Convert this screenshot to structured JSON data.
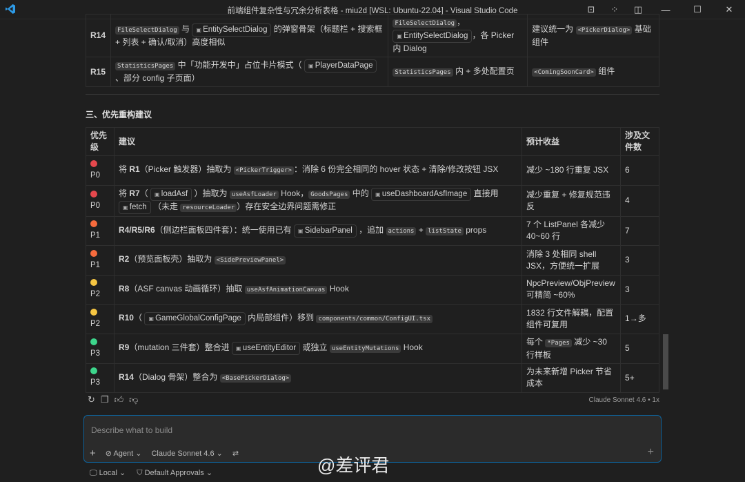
{
  "window": {
    "title": "前端组件复杂性与冗余分析表格 - miu2d [WSL: Ubuntu-22.04] - Visual Studio Code"
  },
  "upper_table": {
    "rows": [
      {
        "id": "R14",
        "desc": [
          {
            "c": "FileSelectDialog"
          },
          {
            "t": " 与 "
          },
          {
            "r": "EntitySelectDialog"
          },
          {
            "t": " 的弹窗骨架（标题栏 + 搜索框 + 列表 + 确认/取消）高度相似"
          }
        ],
        "loc": [
          {
            "c": "FileSelectDialog"
          },
          {
            "t": "，"
          },
          {
            "r": "EntitySelectDialog"
          },
          {
            "t": "，各 Picker 内 Dialog"
          }
        ],
        "suggest": [
          {
            "t": "建议统一为 "
          },
          {
            "c": "<PickerDialog>"
          },
          {
            "t": " 基础组件"
          }
        ]
      },
      {
        "id": "R15",
        "desc": [
          {
            "c": "StatisticsPages"
          },
          {
            "t": " 中「功能开发中」占位卡片模式（ "
          },
          {
            "r": "PlayerDataPage"
          },
          {
            "t": " 、部分 config 子页面）"
          }
        ],
        "loc": [
          {
            "c": "StatisticsPages"
          },
          {
            "t": " 内 + 多处配置页"
          }
        ],
        "suggest": [
          {
            "c": "<ComingSoonCard>"
          },
          {
            "t": " 组件"
          }
        ]
      }
    ]
  },
  "section_heading": "三、优先重构建议",
  "priority_table": {
    "headers": [
      "优先级",
      "建议",
      "预计收益",
      "涉及文件数"
    ],
    "colors": {
      "P0": "#e5484d",
      "P1": "#f76b3d",
      "P2": "#f5c542",
      "P3": "#3dd68c"
    },
    "rows": [
      {
        "p": "P0",
        "s": [
          {
            "t": "将 "
          },
          {
            "b": "R1"
          },
          {
            "t": "（Picker 触发器）抽取为 "
          },
          {
            "c": "<PickerTrigger>"
          },
          {
            "t": "：消除 6 份完全相同的 hover 状态 + 清除/修改按钮 JSX"
          }
        ],
        "gain": "减少 ~180 行重复 JSX",
        "files": "6"
      },
      {
        "p": "P0",
        "s": [
          {
            "t": "将 "
          },
          {
            "b": "R7"
          },
          {
            "t": "（ "
          },
          {
            "r": "loadAsf"
          },
          {
            "t": " ）抽取为 "
          },
          {
            "c": "useAsfLoader"
          },
          {
            "t": " Hook，"
          },
          {
            "c": "GoodsPages"
          },
          {
            "t": " 中的 "
          },
          {
            "r": "useDashboardAsfImage"
          },
          {
            "t": " 直接用 "
          },
          {
            "r": "fetch"
          },
          {
            "t": " （未走 "
          },
          {
            "c": "resourceLoader"
          },
          {
            "t": "）存在安全边界问题需修正"
          }
        ],
        "gain": "减少重复 + 修复规范违反",
        "files": "4"
      },
      {
        "p": "P1",
        "s": [
          {
            "b": "R4/R5/R6"
          },
          {
            "t": "（侧边栏面板四件套）：统一使用已有 "
          },
          {
            "r": "SidebarPanel"
          },
          {
            "t": " ，追加 "
          },
          {
            "c": "actions"
          },
          {
            "t": " + "
          },
          {
            "c": "listState"
          },
          {
            "t": " props"
          }
        ],
        "gain": "7 个 ListPanel 各减少 40~60 行",
        "files": "7"
      },
      {
        "p": "P1",
        "s": [
          {
            "b": "R2"
          },
          {
            "t": "（预览面板壳）抽取为 "
          },
          {
            "c": "<SidePreviewPanel>"
          }
        ],
        "gain": "消除 3 处相同 shell JSX，方便统一扩展",
        "files": "3"
      },
      {
        "p": "P2",
        "s": [
          {
            "b": "R8"
          },
          {
            "t": "（ASF canvas 动画循环）抽取 "
          },
          {
            "c": "useAsfAnimationCanvas"
          },
          {
            "t": " Hook"
          }
        ],
        "gain": "NpcPreview/ObjPreview 可精简 ~60%",
        "files": "3"
      },
      {
        "p": "P2",
        "s": [
          {
            "b": "R10"
          },
          {
            "t": "（ "
          },
          {
            "r": "GameGlobalConfigPage"
          },
          {
            "t": " 内局部组件）移到 "
          },
          {
            "c": "components/common/ConfigUI.tsx"
          }
        ],
        "gain": "1832 行文件解耦，配置组件可复用",
        "files": "1→多"
      },
      {
        "p": "P3",
        "s": [
          {
            "b": "R9"
          },
          {
            "t": "（mutation 三件套）整合进 "
          },
          {
            "r": "useEntityEditor"
          },
          {
            "t": " 或独立 "
          },
          {
            "c": "useEntityMutations"
          },
          {
            "t": " Hook"
          }
        ],
        "gain_seg": [
          {
            "t": "每个 "
          },
          {
            "c": "*Pages"
          },
          {
            "t": " 减少 ~30 行样板"
          }
        ],
        "files": "5"
      },
      {
        "p": "P3",
        "s": [
          {
            "b": "R14"
          },
          {
            "t": "（Dialog 骨架）整合为 "
          },
          {
            "c": "<BasePickerDialog>"
          }
        ],
        "gain": "为未来新增 Picker 节省成本",
        "files": "5+"
      }
    ]
  },
  "model_meta": "Claude Sonnet 4.6 • 1x",
  "chat_input": {
    "placeholder": "Describe what to build",
    "mode": "Agent",
    "model": "Claude Sonnet 4.6"
  },
  "footer": {
    "location": "Local",
    "approvals": "Default Approvals"
  },
  "watermark": "@差评君"
}
